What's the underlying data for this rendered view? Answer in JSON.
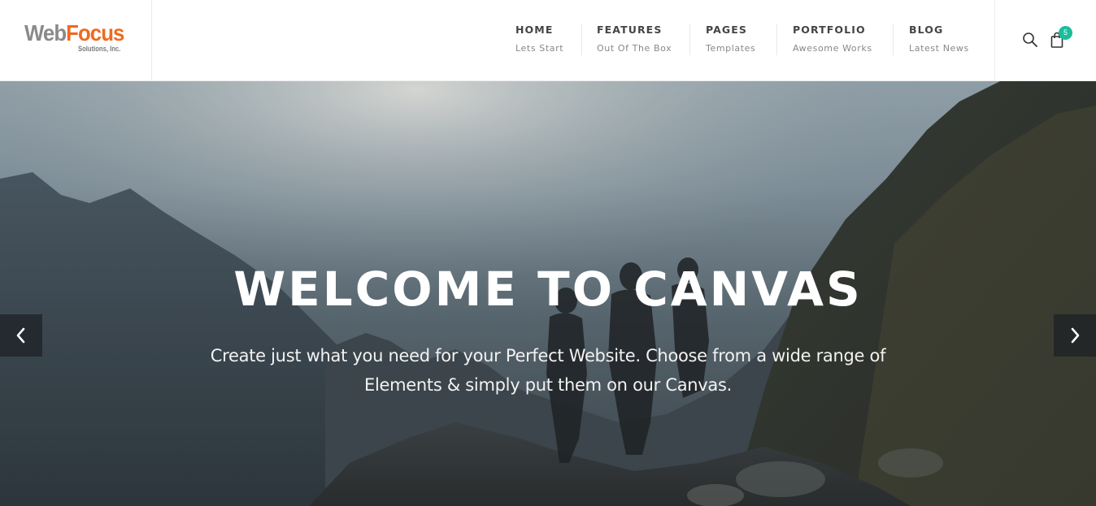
{
  "logo": {
    "word_1": "Web",
    "word_2": "Focus",
    "tagline": "Solutions, Inc."
  },
  "nav": [
    {
      "label": "HOME",
      "sub": "Lets Start"
    },
    {
      "label": "FEATURES",
      "sub": "Out Of The Box"
    },
    {
      "label": "PAGES",
      "sub": "Templates"
    },
    {
      "label": "PORTFOLIO",
      "sub": "Awesome Works"
    },
    {
      "label": "BLOG",
      "sub": "Latest News"
    }
  ],
  "cart": {
    "count": "5"
  },
  "hero": {
    "title": "WELCOME TO CANVAS",
    "text": "Create just what you need for your Perfect Website. Choose from a wide range of Elements & simply put them on our Canvas."
  },
  "colors": {
    "accent": "#1abc9c",
    "logo_orange": "#ef6a1f",
    "logo_gray": "#8a8a8a"
  },
  "icons": {
    "search": "search-icon",
    "cart": "shopping-bag-icon",
    "prev": "chevron-left-icon",
    "next": "chevron-right-icon"
  }
}
